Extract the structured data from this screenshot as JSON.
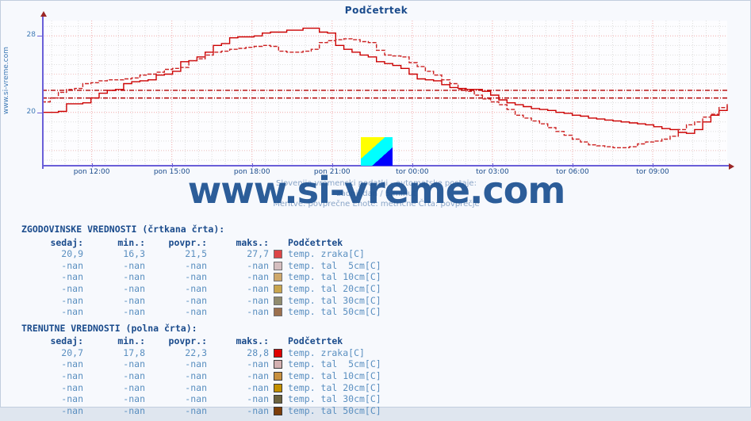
{
  "chart_title": "Podčetrtek",
  "side_label": "www.si-vreme.com",
  "watermark": "www.si-vreme.com",
  "caption": {
    "line1": "Slovenija vremenski podatki - avtomatske postaje:",
    "line2": "zadnji dan / 5 minut",
    "line3": "Meritve: povprečne  Enote: metrične  Črta: povprečje"
  },
  "flag_icon": "slovenia-flag-icon",
  "chart_data": {
    "type": "line",
    "title": "Podčetrtek",
    "xlabel": "",
    "ylabel": "",
    "ylim": [
      14.5,
      29.6
    ],
    "yticks": [
      20,
      28
    ],
    "xticks": [
      "pon 12:00",
      "pon 15:00",
      "pon 18:00",
      "pon 21:00",
      "tor 00:00",
      "tor 03:00",
      "tor 06:00",
      "tor 09:00"
    ],
    "grid": true,
    "legend": "none",
    "series": [
      {
        "name": "temp. zraka[C] - trenutne (polna črta)",
        "style": "solid",
        "color": "#cc0000",
        "x": [
          0,
          1,
          2,
          3,
          4,
          5,
          6,
          7,
          8,
          9,
          10,
          11,
          12,
          13,
          14,
          15,
          16,
          17,
          18,
          19,
          20,
          21,
          22,
          23,
          24,
          25,
          26,
          27,
          28,
          29,
          30,
          31,
          32,
          33,
          34,
          35,
          36,
          37,
          38,
          39,
          40,
          41,
          42,
          43,
          44,
          45,
          46,
          47,
          48,
          49,
          50,
          51,
          52,
          53,
          54,
          55,
          56,
          57,
          58,
          59,
          60,
          61,
          62,
          63,
          64,
          65,
          66,
          67,
          68,
          69,
          70,
          71,
          72,
          73,
          74,
          75,
          76,
          77,
          78,
          79,
          80,
          81,
          82,
          83,
          84
        ],
        "values": [
          20.0,
          20.0,
          20.1,
          20.9,
          20.9,
          21.0,
          21.5,
          22.0,
          22.3,
          22.4,
          23.0,
          23.2,
          23.3,
          23.4,
          23.9,
          24.0,
          24.3,
          25.3,
          25.4,
          25.8,
          26.3,
          27.0,
          27.2,
          27.8,
          27.9,
          27.9,
          28.0,
          28.3,
          28.4,
          28.4,
          28.6,
          28.6,
          28.8,
          28.8,
          28.4,
          28.3,
          27.0,
          26.6,
          26.3,
          26.0,
          25.8,
          25.3,
          25.1,
          24.9,
          24.6,
          24.0,
          23.5,
          23.4,
          23.3,
          22.9,
          22.6,
          22.5,
          22.4,
          22.4,
          22.2,
          21.8,
          21.3,
          21.0,
          20.8,
          20.6,
          20.4,
          20.3,
          20.2,
          20.0,
          19.9,
          19.7,
          19.6,
          19.4,
          19.3,
          19.2,
          19.1,
          19.0,
          18.9,
          18.8,
          18.7,
          18.5,
          18.3,
          18.2,
          17.9,
          17.8,
          18.2,
          19.0,
          19.7,
          20.2,
          20.7
        ]
      },
      {
        "name": "temp. zraka[C] - zgodovinske (črtkana črta)",
        "style": "dashed",
        "color": "#cc2222",
        "x": [
          0,
          1,
          2,
          3,
          4,
          5,
          6,
          7,
          8,
          9,
          10,
          11,
          12,
          13,
          14,
          15,
          16,
          17,
          18,
          19,
          20,
          21,
          22,
          23,
          24,
          25,
          26,
          27,
          28,
          29,
          30,
          31,
          32,
          33,
          34,
          35,
          36,
          37,
          38,
          39,
          40,
          41,
          42,
          43,
          44,
          45,
          46,
          47,
          48,
          49,
          50,
          51,
          52,
          53,
          54,
          55,
          56,
          57,
          58,
          59,
          60,
          61,
          62,
          63,
          64,
          65,
          66,
          67,
          68,
          69,
          70,
          71,
          72,
          73,
          74,
          75,
          76,
          77,
          78,
          79,
          80,
          81,
          82,
          83,
          84
        ],
        "values": [
          21.1,
          21.5,
          22.1,
          22.4,
          22.5,
          23.0,
          23.1,
          23.3,
          23.4,
          23.4,
          23.5,
          23.6,
          23.9,
          24.0,
          24.2,
          24.5,
          24.6,
          24.7,
          25.4,
          25.6,
          26.0,
          26.3,
          26.4,
          26.6,
          26.7,
          26.8,
          26.9,
          27.0,
          26.9,
          26.4,
          26.3,
          26.3,
          26.4,
          26.6,
          27.3,
          27.5,
          27.6,
          27.7,
          27.6,
          27.4,
          27.3,
          26.5,
          26.0,
          25.9,
          25.8,
          25.2,
          24.8,
          24.3,
          23.9,
          23.4,
          23.0,
          22.4,
          22.2,
          21.8,
          21.4,
          21.1,
          20.8,
          20.3,
          19.7,
          19.4,
          19.1,
          18.8,
          18.4,
          18.0,
          17.6,
          17.2,
          16.9,
          16.6,
          16.5,
          16.4,
          16.3,
          16.3,
          16.4,
          16.7,
          16.9,
          17.0,
          17.2,
          17.5,
          18.2,
          18.7,
          19.0,
          19.5,
          19.8,
          20.5,
          20.9
        ]
      }
    ],
    "average_lines": [
      {
        "name": "trenutne povprecje",
        "value": 22.3,
        "style": "dash-dot",
        "color": "#b30000"
      },
      {
        "name": "zgodovinske povprecje",
        "value": 21.5,
        "style": "dash-dot",
        "color": "#b30000"
      }
    ]
  },
  "tables": [
    {
      "section_title": "ZGODOVINSKE VREDNOSTI (črtkana črta):",
      "headers": [
        "sedaj:",
        "min.:",
        "povpr.:",
        "maks.:",
        "Podčetrtek"
      ],
      "rows": [
        {
          "sedaj": "20,9",
          "min": "16,3",
          "povpr": "21,5",
          "maks": "27,7",
          "color": "#d40000",
          "label": "temp. zraka[C]"
        },
        {
          "sedaj": "-nan",
          "min": "-nan",
          "povpr": "-nan",
          "maks": "-nan",
          "color": "#c9a8a8",
          "label": "temp. tal  5cm[C]"
        },
        {
          "sedaj": "-nan",
          "min": "-nan",
          "povpr": "-nan",
          "maks": "-nan",
          "color": "#c08a34",
          "label": "temp. tal 10cm[C]"
        },
        {
          "sedaj": "-nan",
          "min": "-nan",
          "povpr": "-nan",
          "maks": "-nan",
          "color": "#b8860b",
          "label": "temp. tal 20cm[C]"
        },
        {
          "sedaj": "-nan",
          "min": "-nan",
          "povpr": "-nan",
          "maks": "-nan",
          "color": "#6b6137",
          "label": "temp. tal 30cm[C]"
        },
        {
          "sedaj": "-nan",
          "min": "-nan",
          "povpr": "-nan",
          "maks": "-nan",
          "color": "#7a3c0c",
          "label": "temp. tal 50cm[C]"
        }
      ]
    },
    {
      "section_title": "TRENUTNE VREDNOSTI (polna črta):",
      "headers": [
        "sedaj:",
        "min.:",
        "povpr.:",
        "maks.:",
        "Podčetrtek"
      ],
      "rows": [
        {
          "sedaj": "20,7",
          "min": "17,8",
          "povpr": "22,3",
          "maks": "28,8",
          "color": "#e00000",
          "label": "temp. zraka[C]"
        },
        {
          "sedaj": "-nan",
          "min": "-nan",
          "povpr": "-nan",
          "maks": "-nan",
          "color": "#d3b0b0",
          "label": "temp. tal  5cm[C]"
        },
        {
          "sedaj": "-nan",
          "min": "-nan",
          "povpr": "-nan",
          "maks": "-nan",
          "color": "#c89040",
          "label": "temp. tal 10cm[C]"
        },
        {
          "sedaj": "-nan",
          "min": "-nan",
          "povpr": "-nan",
          "maks": "-nan",
          "color": "#c49000",
          "label": "temp. tal 20cm[C]"
        },
        {
          "sedaj": "-nan",
          "min": "-nan",
          "povpr": "-nan",
          "maks": "-nan",
          "color": "#6d6440",
          "label": "temp. tal 30cm[C]"
        },
        {
          "sedaj": "-nan",
          "min": "-nan",
          "povpr": "-nan",
          "maks": "-nan",
          "color": "#7d3e0a",
          "label": "temp. tal 50cm[C]"
        }
      ]
    }
  ]
}
